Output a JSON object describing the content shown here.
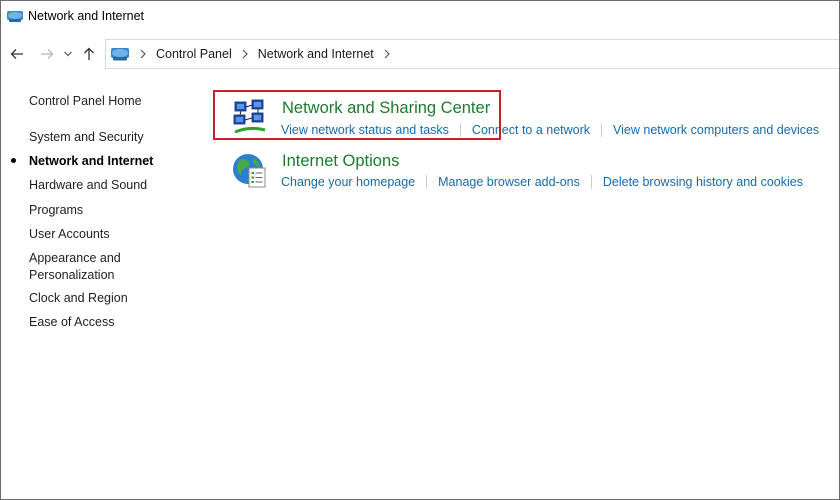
{
  "window": {
    "title": "Network and Internet"
  },
  "address_bar": {
    "crumbs": [
      "Control Panel",
      "Network and Internet"
    ]
  },
  "left_nav": {
    "home": "Control Panel Home",
    "items": [
      {
        "label": "System and Security",
        "current": false
      },
      {
        "label": "Network and Internet",
        "current": true
      },
      {
        "label": "Hardware and Sound",
        "current": false
      },
      {
        "label": "Programs",
        "current": false
      },
      {
        "label": "User Accounts",
        "current": false
      },
      {
        "label": "Appearance and Personalization",
        "current": false
      },
      {
        "label": "Clock and Region",
        "current": false
      },
      {
        "label": "Ease of Access",
        "current": false
      }
    ]
  },
  "sections": [
    {
      "title": "Network and Sharing Center",
      "icon": "network-sharing-center-icon",
      "links": [
        "View network status and tasks",
        "Connect to a network",
        "View network computers and devices"
      ]
    },
    {
      "title": "Internet Options",
      "icon": "internet-options-icon",
      "links": [
        "Change your homepage",
        "Manage browser add-ons",
        "Delete browsing history and cookies"
      ]
    }
  ],
  "colors": {
    "heading_green": "#1e7a2e",
    "link_blue": "#1a6aa8",
    "highlight_red": "#c8202a"
  }
}
